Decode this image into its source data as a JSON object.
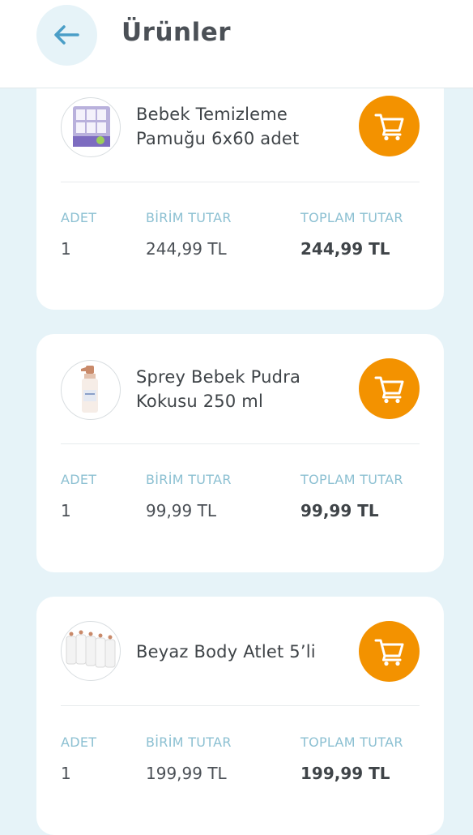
{
  "header": {
    "title": "Ürünler",
    "back_icon": "arrow-left-icon"
  },
  "columns": {
    "qty": "ADET",
    "unit_price": "BİRİM TUTAR",
    "total": "TOPLAM TUTAR"
  },
  "products": [
    {
      "name_line1": "Bebek Temizleme",
      "name_line2": "Pamuğu 6x60 adet",
      "qty": "1",
      "unit_price": "244,99 TL",
      "total": "244,99 TL"
    },
    {
      "name_line1": "Sprey Bebek Pudra",
      "name_line2": "Kokusu 250 ml",
      "qty": "1",
      "unit_price": "99,99 TL",
      "total": "99,99 TL"
    },
    {
      "name_line1": "Beyaz Body Atlet 5’li",
      "name_line2": "",
      "qty": "1",
      "unit_price": "199,99 TL",
      "total": "199,99 TL"
    }
  ],
  "colors": {
    "accent": "#f39200",
    "background": "#e6f3f8",
    "label": "#8cc0d2"
  },
  "icons": {
    "cart": "shopping-cart-icon"
  }
}
